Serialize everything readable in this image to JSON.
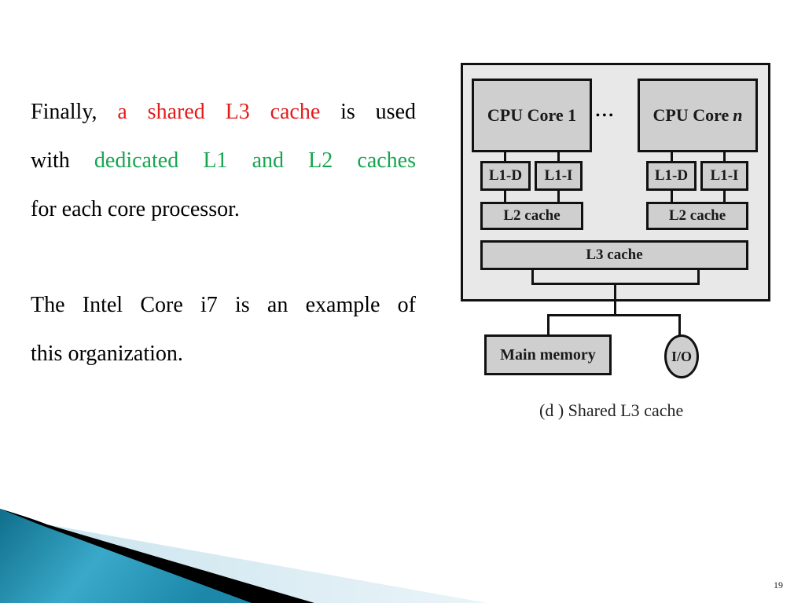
{
  "slide": {
    "paragraph1": {
      "line1": {
        "a": "Finally,",
        "b": "a shared L3 cache",
        "c": "is used"
      },
      "line2": {
        "a": "with",
        "b": "dedicated L1 and L2 caches"
      },
      "line3": "for each core processor."
    },
    "paragraph2": {
      "line1": "The Intel Core i7 is an example of",
      "line2": "this organization."
    },
    "page_number": "19",
    "colors": {
      "highlight_red": "#e31b1b",
      "highlight_green": "#17a550",
      "accent_teal": "#1f8fb0"
    }
  },
  "diagram": {
    "core1": "CPU Core 1",
    "coren_prefix": "CPU Core ",
    "coren_italic": "n",
    "ellipsis": "• • •",
    "l1d": "L1-D",
    "l1i": "L1-I",
    "l2": "L2 cache",
    "l3": "L3 cache",
    "main_memory": "Main memory",
    "io": "I/O",
    "caption": "(d ) Shared L3 cache"
  }
}
